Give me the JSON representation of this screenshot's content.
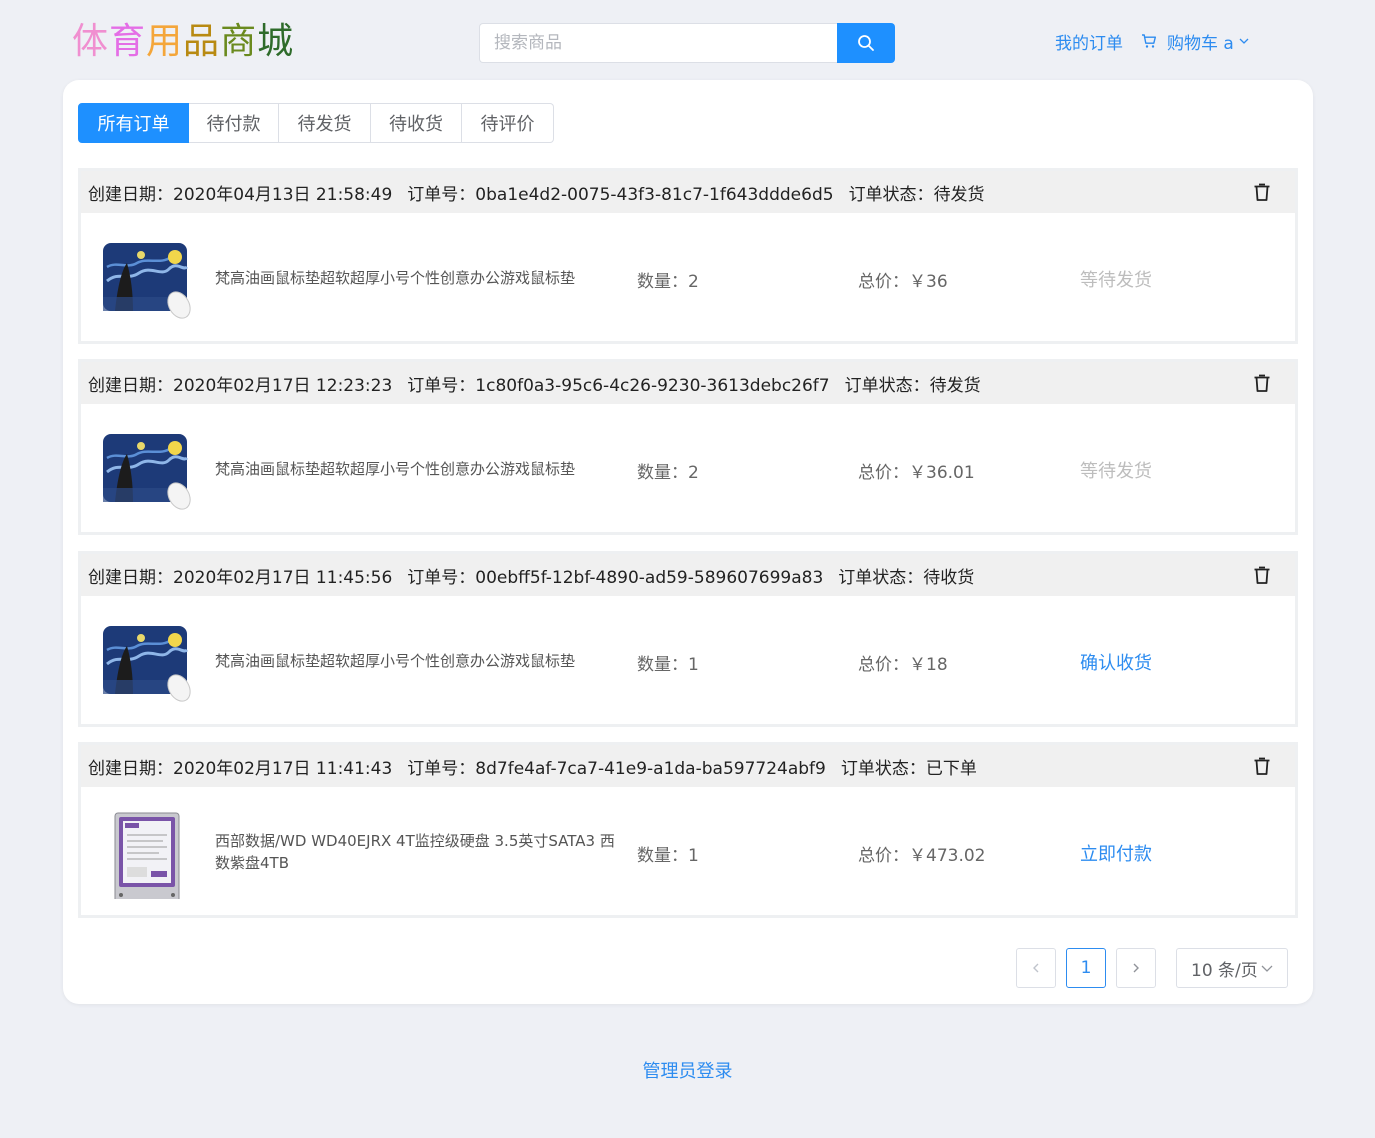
{
  "header": {
    "logo_chars": [
      "体",
      "育",
      "用",
      "品",
      "商",
      "城"
    ],
    "search_placeholder": "搜索商品",
    "my_orders": "我的订单",
    "cart_label": "购物车 a"
  },
  "tabs": [
    {
      "label": "所有订单",
      "active": true
    },
    {
      "label": "待付款",
      "active": false
    },
    {
      "label": "待发货",
      "active": false
    },
    {
      "label": "待收货",
      "active": false
    },
    {
      "label": "待评价",
      "active": false
    }
  ],
  "labels": {
    "created": "创建日期：",
    "order_no": "订单号：",
    "status": "订单状态：",
    "qty": "数量：",
    "total": "总价：￥"
  },
  "orders": [
    {
      "date": "2020年04月13日 21:58:49",
      "id": "0ba1e4d2-0075-43f3-81c7-1f643ddde6d5",
      "status": "待发货",
      "product": "梵高油画鼠标垫超软超厚小号个性创意办公游戏鼠标垫",
      "image": "starry-night-mousepad",
      "qty": "2",
      "total": "36",
      "action": "等待发货"
    },
    {
      "date": "2020年02月17日 12:23:23",
      "id": "1c80f0a3-95c6-4c26-9230-3613debc26f7",
      "status": "待发货",
      "product": "梵高油画鼠标垫超软超厚小号个性创意办公游戏鼠标垫",
      "image": "starry-night-mousepad",
      "qty": "2",
      "total": "36.01",
      "action": "等待发货"
    },
    {
      "date": "2020年02月17日 11:45:56",
      "id": "00ebff5f-12bf-4890-ad59-589607699a83",
      "status": "待收货",
      "product": "梵高油画鼠标垫超软超厚小号个性创意办公游戏鼠标垫",
      "image": "starry-night-mousepad",
      "qty": "1",
      "total": "18",
      "action": "确认收货"
    },
    {
      "date": "2020年02月17日 11:41:43",
      "id": "8d7fe4af-7ca7-41e9-a1da-ba597724abf9",
      "status": "已下单",
      "product": "西部数据/WD WD40EJRX 4T监控级硬盘 3.5英寸SATA3 西数紫盘4TB",
      "image": "wd-purple-hdd",
      "qty": "1",
      "total": "473.02",
      "action": "立即付款"
    }
  ],
  "pagination": {
    "current_page": "1",
    "page_size": "10 条/页"
  },
  "footer": {
    "admin_login": "管理员登录"
  },
  "colors": {
    "primary": "#1e90ff",
    "link": "#2d8cf0",
    "disabled": "#bdbdbd",
    "background": "#eef0f5"
  }
}
